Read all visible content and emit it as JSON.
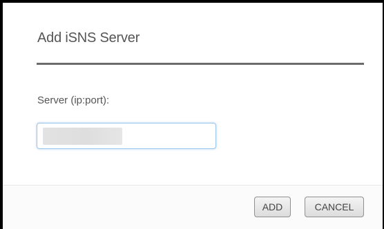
{
  "dialog": {
    "title": "Add iSNS Server",
    "server_field": {
      "label": "Server (ip:port):",
      "value": ""
    },
    "buttons": {
      "add_label": "ADD",
      "cancel_label": "CANCEL"
    }
  }
}
